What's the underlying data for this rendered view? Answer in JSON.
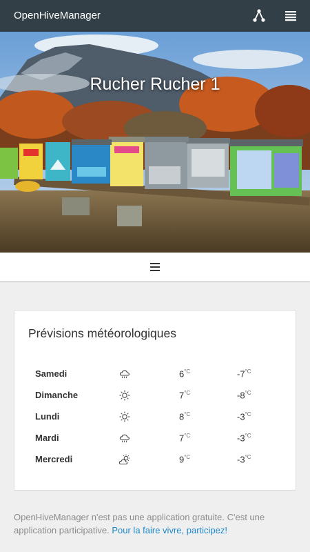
{
  "app": {
    "title": "OpenHiveManager"
  },
  "icons": {
    "network": "network-icon",
    "menu": "hamburger-menu-icon"
  },
  "hero": {
    "title": "Rucher Rucher 1"
  },
  "forecast": {
    "title": "Prévisions météorologiques",
    "unit": "°C",
    "days": [
      {
        "day": "Samedi",
        "icon": "rain-cloud-icon",
        "high": "6",
        "low": "-7"
      },
      {
        "day": "Dimanche",
        "icon": "sun-icon",
        "high": "7",
        "low": "-8"
      },
      {
        "day": "Lundi",
        "icon": "sun-icon",
        "high": "8",
        "low": "-3"
      },
      {
        "day": "Mardi",
        "icon": "rain-cloud-icon",
        "high": "7",
        "low": "-3"
      },
      {
        "day": "Mercredi",
        "icon": "partly-cloudy-icon",
        "high": "9",
        "low": "-3"
      }
    ]
  },
  "footer": {
    "text": "OpenHiveManager n'est pas une application gratuite. C'est une application participative. ",
    "link": "Pour la faire vivre, participez!"
  },
  "colors": {
    "topbar": "#323f47",
    "link": "#1e88c8",
    "background": "#efefef"
  }
}
